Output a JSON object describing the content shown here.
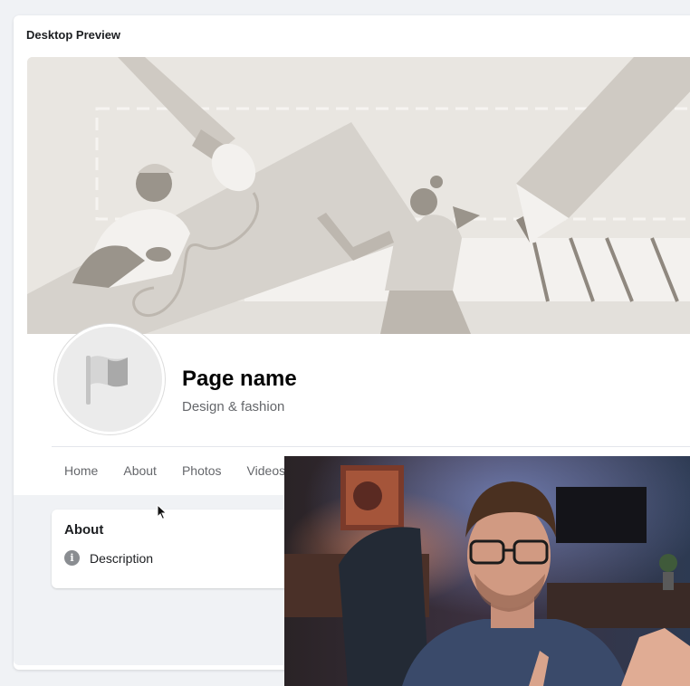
{
  "preview": {
    "title": "Desktop Preview"
  },
  "page": {
    "name": "Page name",
    "category": "Design & fashion"
  },
  "tabs": [
    {
      "label": "Home"
    },
    {
      "label": "About"
    },
    {
      "label": "Photos"
    },
    {
      "label": "Videos"
    }
  ],
  "about": {
    "title": "About",
    "description_label": "Description",
    "info_icon_glyph": "i"
  },
  "colors": {
    "background": "#f0f2f5",
    "card": "#ffffff",
    "text_primary": "#050505",
    "text_secondary": "#65676b"
  },
  "icons": {
    "profile": "flag-icon",
    "info": "info-icon",
    "pointer": "mouse-cursor-icon"
  }
}
